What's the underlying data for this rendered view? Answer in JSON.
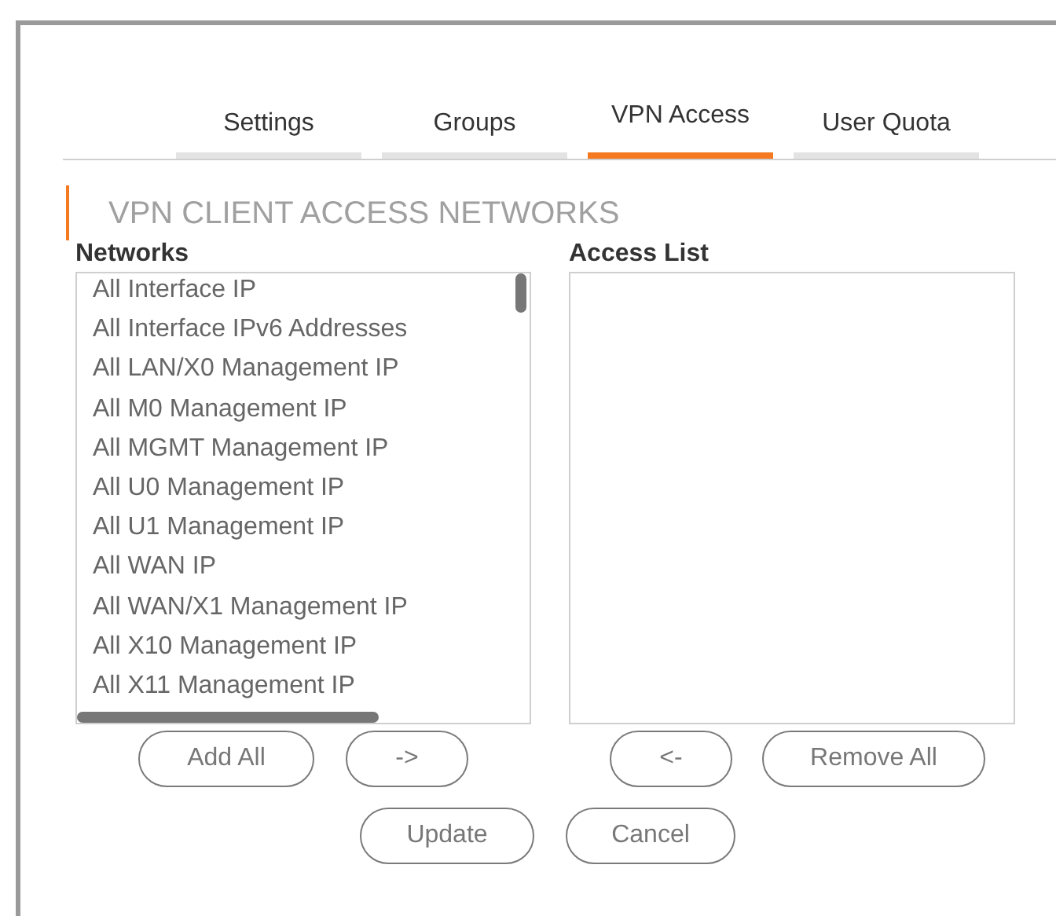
{
  "tabs": [
    {
      "label": "Settings",
      "selected": false
    },
    {
      "label": "Groups",
      "selected": false
    },
    {
      "label": "VPN Access",
      "selected": true
    },
    {
      "label": "User Quota",
      "selected": false
    }
  ],
  "section_title": "VPN CLIENT ACCESS NETWORKS",
  "networks": {
    "label": "Networks",
    "items": [
      "All Interface IP",
      "All Interface IPv6 Addresses",
      "All LAN/X0 Management IP",
      "All M0 Management IP",
      "All MGMT Management IP",
      "All U0 Management IP",
      "All U1 Management IP",
      "All WAN IP",
      "All WAN/X1 Management IP",
      "All X10 Management IP",
      "All X11 Management IP"
    ]
  },
  "access_list": {
    "label": "Access List"
  },
  "list_buttons": [
    "Add All",
    "->",
    "<-",
    "Remove All"
  ],
  "form_buttons": [
    "Update",
    "Cancel"
  ]
}
